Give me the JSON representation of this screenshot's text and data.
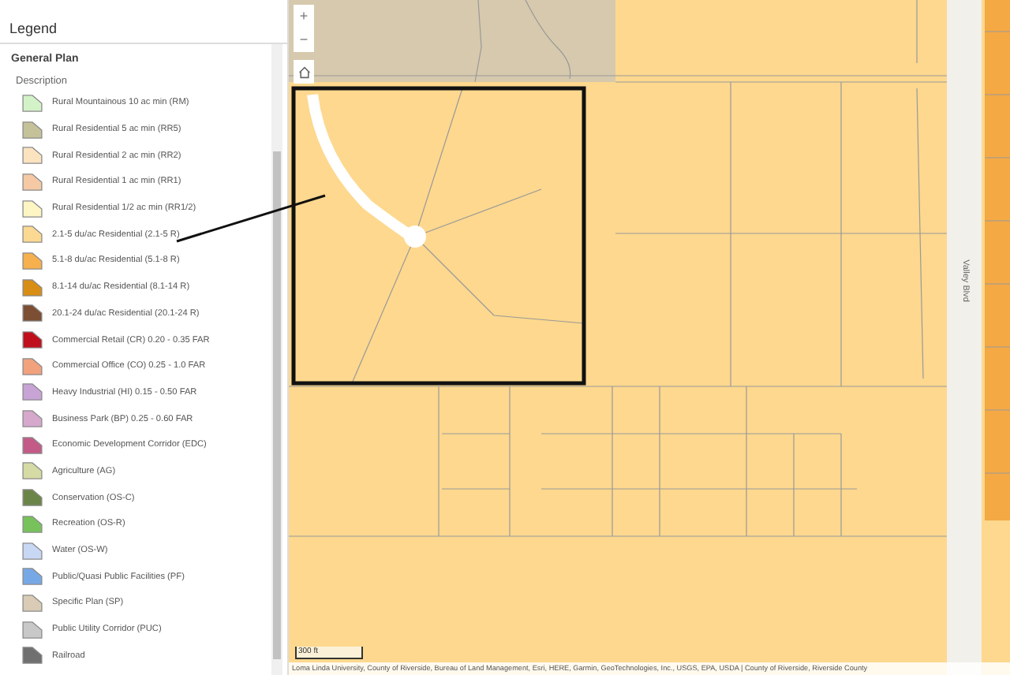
{
  "legend": {
    "title": "Legend",
    "layer": "General Plan",
    "field": "Description",
    "items": [
      {
        "label": "Rural Mountainous 10 ac min (RM)",
        "color": "#d4f2c8"
      },
      {
        "label": "Rural Residential 5 ac min (RR5)",
        "color": "#c5c29a"
      },
      {
        "label": "Rural Residential 2 ac min (RR2)",
        "color": "#fbe3c0"
      },
      {
        "label": "Rural Residential 1 ac min (RR1)",
        "color": "#f5c9a4"
      },
      {
        "label": "Rural Residential 1/2 ac min (RR1/2)",
        "color": "#fdf5c4"
      },
      {
        "label": "2.1-5 du/ac Residential (2.1-5 R)",
        "color": "#fcd992"
      },
      {
        "label": "5.1-8 du/ac Residential (5.1-8 R)",
        "color": "#f6b04e"
      },
      {
        "label": "8.1-14 du/ac Residential (8.1-14 R)",
        "color": "#d88e15"
      },
      {
        "label": "20.1-24 du/ac Residential (20.1-24 R)",
        "color": "#7c4e33"
      },
      {
        "label": "Commercial Retail (CR) 0.20 - 0.35 FAR",
        "color": "#c0101d"
      },
      {
        "label": "Commercial Office (CO) 0.25 - 1.0 FAR",
        "color": "#f1a17c"
      },
      {
        "label": "Heavy Industrial (HI) 0.15 - 0.50 FAR",
        "color": "#c7a3d6"
      },
      {
        "label": "Business Park (BP) 0.25 - 0.60 FAR",
        "color": "#d6a8cc"
      },
      {
        "label": "Economic Development Corridor (EDC)",
        "color": "#c45a87"
      },
      {
        "label": "Agriculture (AG)",
        "color": "#d6daa4"
      },
      {
        "label": "Conservation (OS-C)",
        "color": "#6b8548"
      },
      {
        "label": "Recreation (OS-R)",
        "color": "#77c25a"
      },
      {
        "label": "Water (OS-W)",
        "color": "#c8d7f4"
      },
      {
        "label": "Public/Quasi Public Facilities (PF)",
        "color": "#77a8e6"
      },
      {
        "label": "Specific Plan (SP)",
        "color": "#d9cbb5"
      },
      {
        "label": "Public Utility Corridor (PUC)",
        "color": "#c8c8c8"
      },
      {
        "label": "Railroad",
        "color": "#707070"
      }
    ]
  },
  "map": {
    "zoom_in": "+",
    "zoom_out": "−",
    "street_label": "Valley Blvd",
    "scale": "300 ft",
    "attribution": "Loma Linda University, County of Riverside, Bureau of Land Management, Esri, HERE, Garmin, GeoTechnologies, Inc., USGS, EPA, USDA | County of Riverside, Riverside County"
  }
}
